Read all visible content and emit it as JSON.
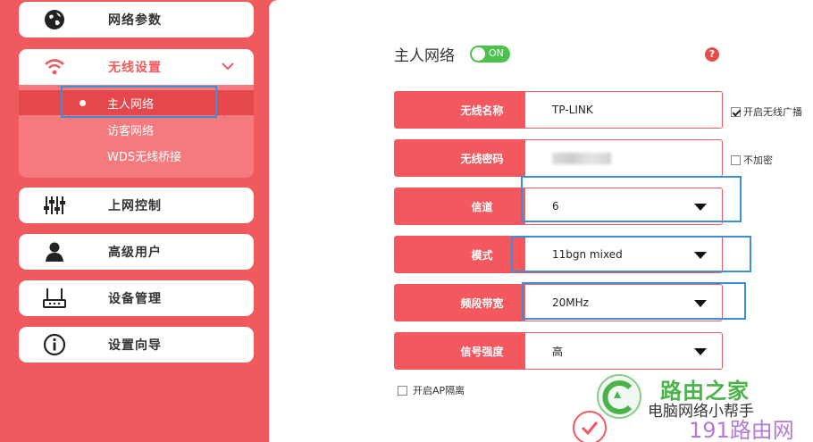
{
  "sidebar": {
    "items": [
      {
        "label": "网络参数",
        "icon": "globe-icon"
      },
      {
        "label": "无线设置",
        "icon": "wifi-icon"
      },
      {
        "label": "上网控制",
        "icon": "sliders-icon"
      },
      {
        "label": "高级用户",
        "icon": "user-icon"
      },
      {
        "label": "设备管理",
        "icon": "router-icon"
      },
      {
        "label": "设置向导",
        "icon": "info-icon"
      }
    ],
    "submenu": [
      {
        "label": "主人网络"
      },
      {
        "label": "访客网络"
      },
      {
        "label": "WDS无线桥接"
      }
    ]
  },
  "main": {
    "title": "主人网络",
    "toggle": "ON",
    "help": "?",
    "fields": {
      "ssid": {
        "label": "无线名称",
        "value": "TP-LINK"
      },
      "password": {
        "label": "无线密码"
      },
      "channel": {
        "label": "信道",
        "value": "6"
      },
      "mode": {
        "label": "模式",
        "value": "11bgn mixed"
      },
      "bandwidth": {
        "label": "频段带宽",
        "value": "20MHz"
      },
      "power": {
        "label": "信号强度",
        "value": "高"
      }
    },
    "enable_broadcast": "开启无线广播",
    "no_encrypt": "不加密",
    "ap_isolation": "开启AP隔离"
  },
  "watermark": {
    "line1": "路由之家",
    "line2": "电脑网络小帮手",
    "line3": "191路由网"
  },
  "colors": {
    "accent": "#f05a5e",
    "highlight": "#3c8fd6",
    "toggle": "#4cc24c"
  }
}
